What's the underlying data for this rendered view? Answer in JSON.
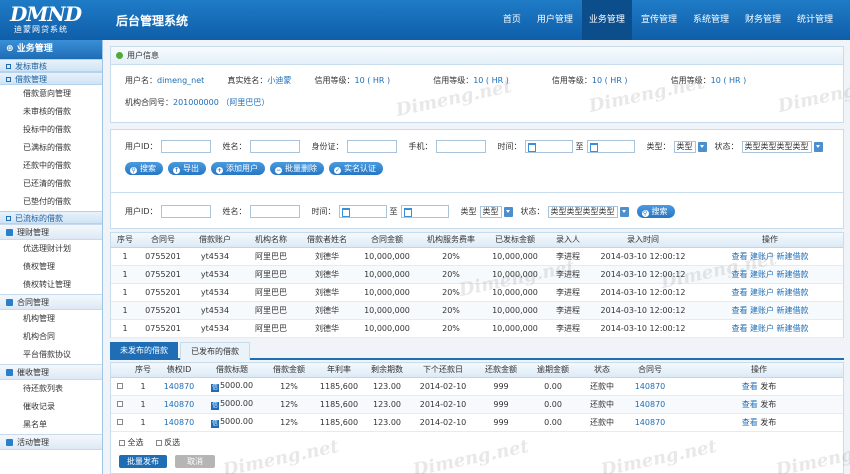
{
  "logo": {
    "main": "DMND",
    "sub": "迪蒙网贷系统"
  },
  "system_title": "后台管理系统",
  "nav": [
    "首页",
    "用户管理",
    "业务管理",
    "宣传管理",
    "系统管理",
    "财务管理",
    "统计管理"
  ],
  "nav_active": "业务管理",
  "sidebar": {
    "header": "业务管理",
    "groups": [
      {
        "title": "发标审核",
        "items": []
      },
      {
        "title": "借款管理",
        "items": [
          "借款意向管理",
          "未审核的借款",
          "投标中的借款",
          "已满标的借款",
          "还款中的借款",
          "已还清的借款",
          "已垫付的借款"
        ]
      },
      {
        "title": "已流标的借款",
        "items": []
      }
    ],
    "sections": [
      {
        "title": "理财管理",
        "items": [
          "优选理财计划",
          "债权管理",
          "债权转让管理"
        ]
      },
      {
        "title": "合同管理",
        "items": [
          "机构管理",
          "机构合同",
          "平台借款协议"
        ]
      },
      {
        "title": "催收管理",
        "items": [
          "待还款列表",
          "催收记录",
          "黑名单"
        ]
      },
      {
        "title": "活动管理",
        "items": []
      }
    ]
  },
  "user_info": {
    "title": "用户信息",
    "username_label": "用户名：",
    "username": "dimeng_net",
    "realname_label": "真实姓名：",
    "realname": "小迪蒙",
    "credit_label": "信用等级：",
    "credit": "10 ( HR )",
    "contract_label": "机构合同号：",
    "contract": "201000000 （阿里巴巴）"
  },
  "filter1": {
    "userid": "用户ID：",
    "name": "姓名：",
    "idcard": "身份证：",
    "phone": "手机：",
    "time": "时间：",
    "to": "至",
    "type": "类型：",
    "type_value": "类型",
    "status": "状态：",
    "status_value": "类型类型类型类型",
    "buttons": [
      "搜索",
      "导出",
      "添加用户",
      "批量删除",
      "实名认证"
    ]
  },
  "filter2": {
    "userid": "用户ID：",
    "name": "姓名：",
    "time": "时间：",
    "to": "至",
    "type": "类型",
    "type_value": "类型",
    "status": "状态：",
    "status_value": "类型类型类型类型",
    "search": "搜索"
  },
  "table1": {
    "headers": [
      "序号",
      "合同号",
      "借款账户",
      "机构名称",
      "借款者姓名",
      "合同金额",
      "机构服务费率",
      "已发标金额",
      "录入人",
      "录入时间",
      "操作"
    ],
    "rows": [
      [
        "1",
        "0755201",
        "yt4534",
        "阿里巴巴",
        "刘德华",
        "10,000,000",
        "20%",
        "10,000,000",
        "李进程",
        "2014-03-10 12:00:12"
      ],
      [
        "1",
        "0755201",
        "yt4534",
        "阿里巴巴",
        "刘德华",
        "10,000,000",
        "20%",
        "10,000,000",
        "李进程",
        "2014-03-10 12:00:12"
      ],
      [
        "1",
        "0755201",
        "yt4534",
        "阿里巴巴",
        "刘德华",
        "10,000,000",
        "20%",
        "10,000,000",
        "李进程",
        "2014-03-10 12:00:12"
      ],
      [
        "1",
        "0755201",
        "yt4534",
        "阿里巴巴",
        "刘德华",
        "10,000,000",
        "20%",
        "10,000,000",
        "李进程",
        "2014-03-10 12:00:12"
      ],
      [
        "1",
        "0755201",
        "yt4534",
        "阿里巴巴",
        "刘德华",
        "10,000,000",
        "20%",
        "10,000,000",
        "李进程",
        "2014-03-10 12:00:12"
      ]
    ],
    "actions": [
      "查看",
      "建账户",
      "新建借款"
    ]
  },
  "tabs": [
    "未发布的借款",
    "已发布的借款"
  ],
  "table2": {
    "headers": [
      "",
      "序号",
      "债权ID",
      "借款标题",
      "借款金额",
      "年利率",
      "剩余期数",
      "下个还款日",
      "还款金额",
      "逾期金额",
      "状态",
      "合同号",
      "操作"
    ],
    "amount_icon": "信",
    "rows": [
      [
        "1",
        "140870",
        "5000.00",
        "12%",
        "1185,600",
        "123.00",
        "2014-02-10",
        "999",
        "0.00",
        "还款中",
        "140870"
      ],
      [
        "1",
        "140870",
        "5000.00",
        "12%",
        "1185,600",
        "123.00",
        "2014-02-10",
        "999",
        "0.00",
        "还款中",
        "140870"
      ],
      [
        "1",
        "140870",
        "5000.00",
        "12%",
        "1185,600",
        "123.00",
        "2014-02-10",
        "999",
        "0.00",
        "还款中",
        "140870"
      ]
    ],
    "actions": [
      "查看",
      "发布"
    ],
    "select_all": "全选",
    "invert": "反选",
    "publish_btn": "批量发布",
    "cancel_btn": "取消"
  },
  "watermark": "Dimeng.net",
  "colors": {
    "primary": "#1e6db5",
    "topbar": "#1672bf",
    "link": "#1e6db5"
  }
}
